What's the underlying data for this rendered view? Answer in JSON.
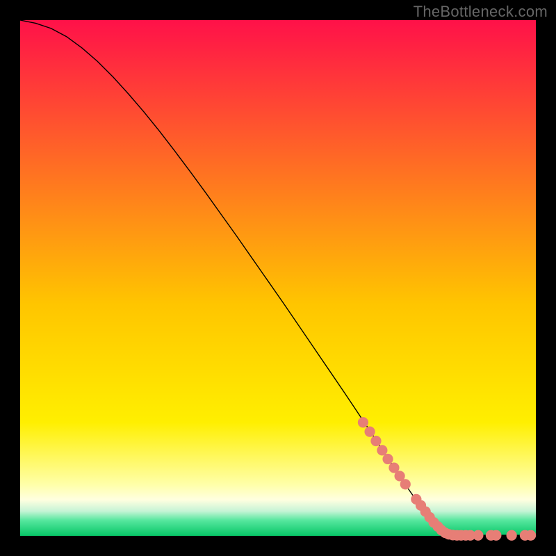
{
  "watermark": "TheBottleneck.com",
  "colors": {
    "black": "#000000",
    "curve": "#000000",
    "dot": "#e77e76",
    "gradient_top": "#ff1149",
    "gradient_mid": "#ffe000",
    "gradient_pale": "#ffffcc",
    "gradient_green_top": "#a8f2bf",
    "gradient_green_mid": "#2fe386",
    "gradient_green_bottom": "#07c667"
  },
  "chart_data": {
    "type": "line",
    "title": "",
    "xlabel": "",
    "ylabel": "",
    "xlim": [
      0,
      100
    ],
    "ylim": [
      0,
      100
    ],
    "curve": {
      "x": [
        0,
        3,
        6,
        9,
        12,
        15,
        18,
        21,
        24,
        27,
        30,
        33,
        36,
        39,
        42,
        45,
        48,
        51,
        54,
        57,
        60,
        63,
        66,
        69,
        72,
        75,
        78,
        81,
        84,
        86,
        88,
        90,
        92,
        94,
        96,
        98,
        100
      ],
      "y": [
        100,
        99.4,
        98.4,
        96.8,
        94.6,
        92.0,
        89.0,
        85.7,
        82.2,
        78.5,
        74.6,
        70.6,
        66.5,
        62.3,
        58.1,
        53.8,
        49.5,
        45.2,
        40.8,
        36.4,
        32.0,
        27.6,
        23.1,
        18.6,
        14.0,
        9.5,
        5.2,
        1.6,
        0.2,
        0.1,
        0.1,
        0.1,
        0.1,
        0.1,
        0.1,
        0.1,
        0.1
      ]
    },
    "dots": [
      {
        "x": 66.5,
        "y": 22.0
      },
      {
        "x": 67.8,
        "y": 20.2
      },
      {
        "x": 69.0,
        "y": 18.4
      },
      {
        "x": 70.2,
        "y": 16.6
      },
      {
        "x": 71.3,
        "y": 14.9
      },
      {
        "x": 72.5,
        "y": 13.2
      },
      {
        "x": 73.6,
        "y": 11.6
      },
      {
        "x": 74.7,
        "y": 10.0
      },
      {
        "x": 76.8,
        "y": 7.1
      },
      {
        "x": 77.7,
        "y": 5.9
      },
      {
        "x": 78.6,
        "y": 4.7
      },
      {
        "x": 79.4,
        "y": 3.6
      },
      {
        "x": 80.2,
        "y": 2.6
      },
      {
        "x": 81.0,
        "y": 1.8
      },
      {
        "x": 81.7,
        "y": 1.1
      },
      {
        "x": 82.4,
        "y": 0.6
      },
      {
        "x": 83.1,
        "y": 0.3
      },
      {
        "x": 83.9,
        "y": 0.15
      },
      {
        "x": 84.7,
        "y": 0.1
      },
      {
        "x": 85.5,
        "y": 0.1
      },
      {
        "x": 86.4,
        "y": 0.1
      },
      {
        "x": 87.3,
        "y": 0.1
      },
      {
        "x": 88.8,
        "y": 0.1
      },
      {
        "x": 91.3,
        "y": 0.1
      },
      {
        "x": 92.3,
        "y": 0.1
      },
      {
        "x": 95.3,
        "y": 0.1
      },
      {
        "x": 97.9,
        "y": 0.1
      },
      {
        "x": 99.0,
        "y": 0.1
      }
    ]
  }
}
